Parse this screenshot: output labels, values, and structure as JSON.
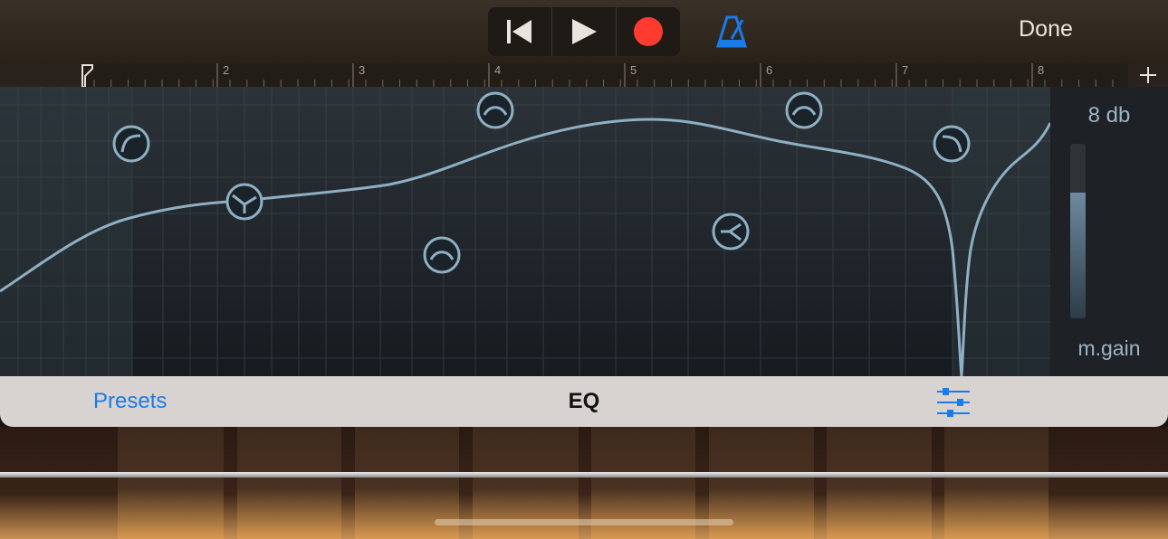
{
  "toolbar": {
    "done_label": "Done",
    "icons": [
      "rewind-icon",
      "play-icon",
      "record-icon",
      "metronome-icon"
    ],
    "record_color": "#ff3b30",
    "metronome_color": "#1a7bea"
  },
  "ruler": {
    "bars": [
      "2",
      "3",
      "4",
      "5",
      "6",
      "7",
      "8"
    ],
    "add_icon": "plus-icon"
  },
  "eq": {
    "title": "EQ",
    "presets_label": "Presets",
    "gain_value": "8 db",
    "gain_label": "m.gain",
    "gain_level": 0.72,
    "settings_icon": "sliders-icon",
    "accent_color": "#1a7bea",
    "curve_color": "#8fb0c4",
    "band_handles": [
      "low-cut-handle",
      "low-shelf-handle",
      "peak-band-1-handle",
      "peak-band-2-handle",
      "peak-band-3-handle",
      "high-shelf-handle",
      "peak-band-4-handle",
      "high-cut-handle"
    ]
  }
}
